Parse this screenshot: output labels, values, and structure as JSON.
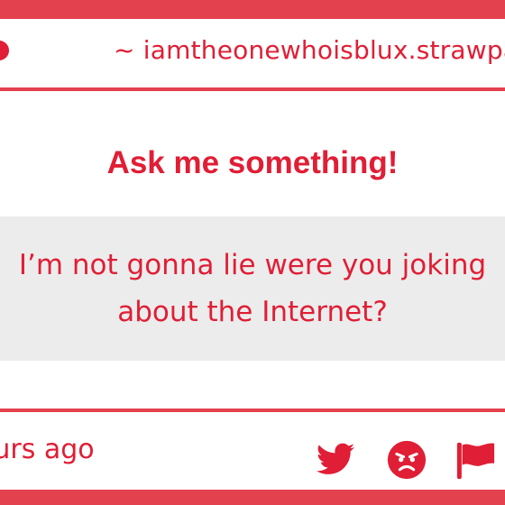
{
  "colors": {
    "brand_red": "#e01e35",
    "border_red": "#e3414d",
    "question_bg": "#ececec"
  },
  "address_bar": {
    "url": "~ iamtheonewhoisblux.strawpage"
  },
  "main": {
    "heading": "Ask me something!",
    "question": "I’m not gonna lie were you joking\nabout the Internet?"
  },
  "footer": {
    "timestamp": "ours ago",
    "icons": [
      "twitter-icon",
      "angry-face-icon",
      "flag-icon"
    ]
  }
}
